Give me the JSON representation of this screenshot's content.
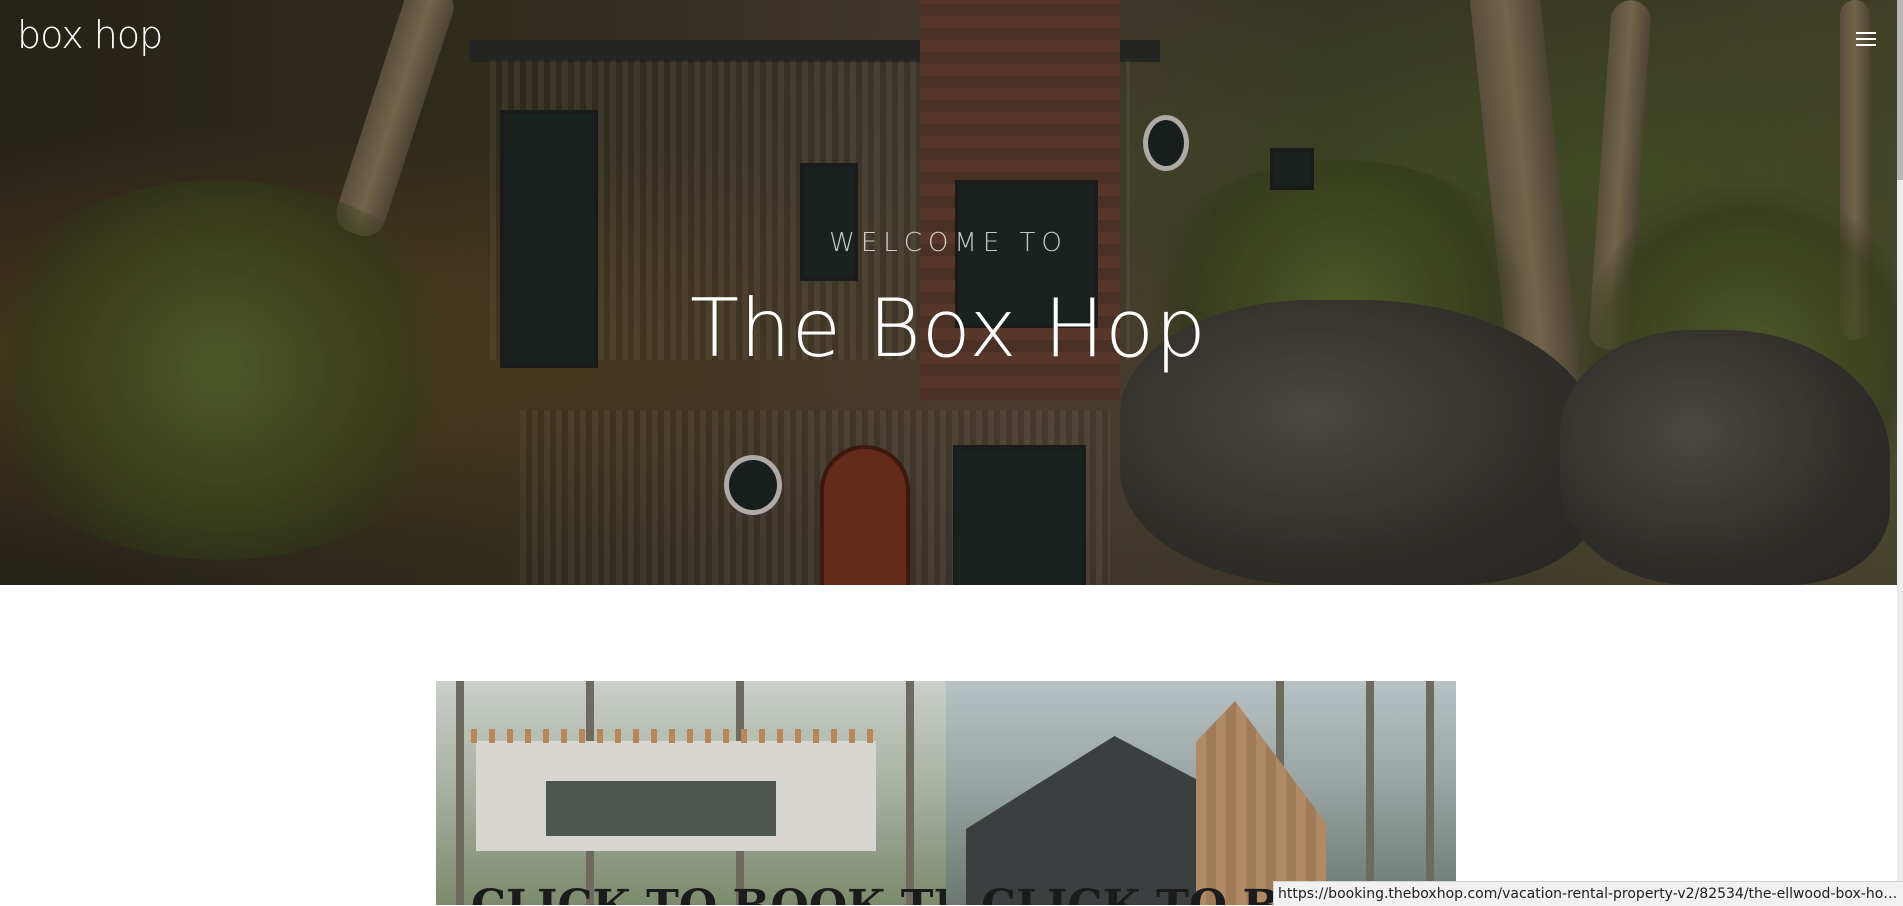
{
  "header": {
    "brand": "box hop",
    "menu_icon": "hamburger-menu-icon"
  },
  "hero": {
    "eyebrow": "WELCOME TO",
    "title": "The Box Hop"
  },
  "cards": [
    {
      "title": "CLICK TO BOOK THE"
    },
    {
      "title": "CLICK TO BOO"
    }
  ],
  "status_bar": {
    "url": "https://booking.theboxhop.com/vacation-rental-property-v2/82534/the-ellwood-box-hop..."
  }
}
